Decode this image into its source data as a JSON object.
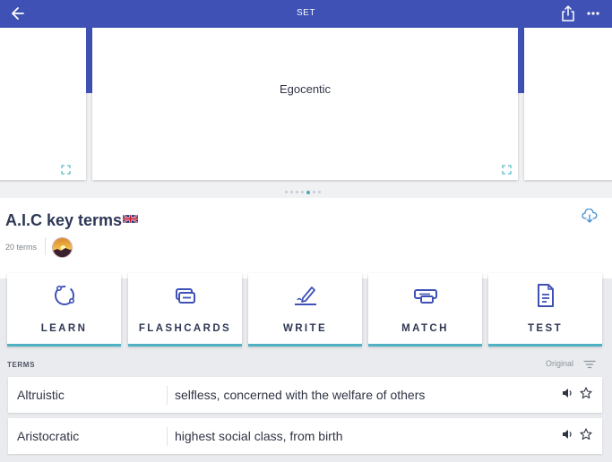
{
  "topbar": {
    "title": "SET"
  },
  "carousel": {
    "current_word": "Egocentic",
    "dot_count": 7,
    "active_dot": 4
  },
  "set": {
    "title": "A.I.C key terms",
    "term_count": "20 terms"
  },
  "modes": [
    {
      "label": "LEARN",
      "icon": "learn-icon"
    },
    {
      "label": "FLASHCARDS",
      "icon": "flashcards-icon"
    },
    {
      "label": "WRITE",
      "icon": "write-icon"
    },
    {
      "label": "MATCH",
      "icon": "match-icon"
    },
    {
      "label": "TEST",
      "icon": "test-icon"
    }
  ],
  "terms_section": {
    "header": "TERMS",
    "sort_label": "Original",
    "rows": [
      {
        "term": "Altruistic",
        "definition": "selfless, concerned with the welfare of others"
      },
      {
        "term": "Aristocratic",
        "definition": "highest social class, from birth"
      }
    ]
  },
  "colors": {
    "brand": "#3f51b5",
    "accent": "#4fb2c4"
  }
}
